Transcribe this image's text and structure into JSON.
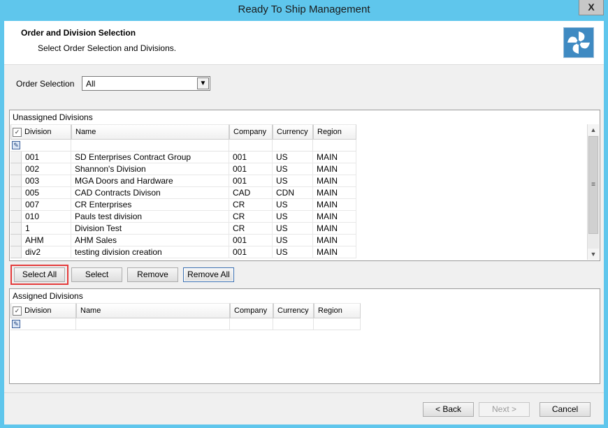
{
  "window": {
    "title": "Ready To Ship Management",
    "close_symbol": "X"
  },
  "header": {
    "title": "Order and Division Selection",
    "subtitle": "Select Order Selection and Divisions.",
    "logo_icon": "pinwheel-logo-icon",
    "logo_color": "#3f8ac2"
  },
  "order_selection": {
    "label": "Order Selection",
    "value": "All"
  },
  "unassigned": {
    "title": "Unassigned Divisions",
    "columns": [
      "Division",
      "Name",
      "Company",
      "Currency",
      "Region"
    ],
    "rows": [
      [
        "001",
        "SD Enterprises Contract Group",
        "001",
        "US",
        "MAIN"
      ],
      [
        "002",
        "Shannon's Division",
        "001",
        "US",
        "MAIN"
      ],
      [
        "003",
        "MGA Doors and Hardware",
        "001",
        "US",
        "MAIN"
      ],
      [
        "005",
        "CAD Contracts Divison",
        "CAD",
        "CDN",
        "MAIN"
      ],
      [
        "007",
        "CR Enterprises",
        "CR",
        "US",
        "MAIN"
      ],
      [
        "010",
        "Pauls test division",
        "CR",
        "US",
        "MAIN"
      ],
      [
        "1",
        "Division Test",
        "CR",
        "US",
        "MAIN"
      ],
      [
        "AHM",
        "AHM Sales",
        "001",
        "US",
        "MAIN"
      ],
      [
        "div2",
        "testing division creation",
        "001",
        "US",
        "MAIN"
      ]
    ]
  },
  "actions": {
    "select_all": "Select All",
    "select": "Select",
    "remove": "Remove",
    "remove_all": "Remove All"
  },
  "assigned": {
    "title": "Assigned Divisions",
    "columns": [
      "Division",
      "Name",
      "Company",
      "Currency",
      "Region"
    ]
  },
  "footer": {
    "back": "< Back",
    "next": "Next >",
    "cancel": "Cancel"
  },
  "colors": {
    "titlebar": "#5fc6ec",
    "highlight": "#e43b3b"
  }
}
